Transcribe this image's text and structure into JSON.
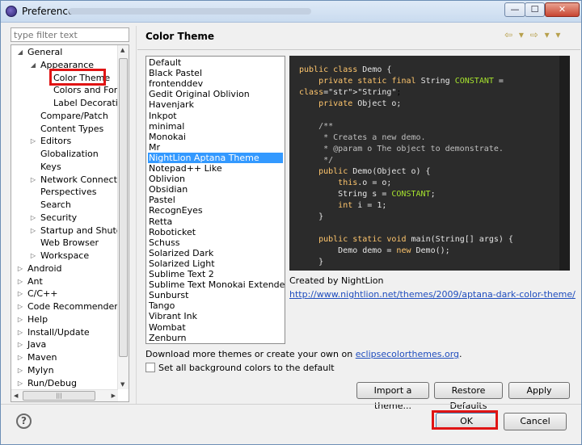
{
  "window": {
    "title": "Preferences",
    "controls": {
      "minimize": "—",
      "maximize": "☐",
      "close": "✕"
    }
  },
  "filter": {
    "placeholder": "type filter text"
  },
  "tree": [
    {
      "label": "General",
      "arrow": "▲",
      "depth": 0
    },
    {
      "label": "Appearance",
      "arrow": "▲",
      "depth": 1
    },
    {
      "label": "Color Theme",
      "arrow": "",
      "depth": 2
    },
    {
      "label": "Colors and Font",
      "arrow": "",
      "depth": 2
    },
    {
      "label": "Label Decoration",
      "arrow": "",
      "depth": 2
    },
    {
      "label": "Compare/Patch",
      "arrow": "",
      "depth": 1
    },
    {
      "label": "Content Types",
      "arrow": "",
      "depth": 1
    },
    {
      "label": "Editors",
      "arrow": "▷",
      "depth": 1
    },
    {
      "label": "Globalization",
      "arrow": "",
      "depth": 1
    },
    {
      "label": "Keys",
      "arrow": "",
      "depth": 1
    },
    {
      "label": "Network Connection",
      "arrow": "▷",
      "depth": 1
    },
    {
      "label": "Perspectives",
      "arrow": "",
      "depth": 1
    },
    {
      "label": "Search",
      "arrow": "",
      "depth": 1
    },
    {
      "label": "Security",
      "arrow": "▷",
      "depth": 1
    },
    {
      "label": "Startup and Shutdo",
      "arrow": "▷",
      "depth": 1
    },
    {
      "label": "Web Browser",
      "arrow": "",
      "depth": 1
    },
    {
      "label": "Workspace",
      "arrow": "▷",
      "depth": 1
    },
    {
      "label": "Android",
      "arrow": "▷",
      "depth": 0
    },
    {
      "label": "Ant",
      "arrow": "▷",
      "depth": 0
    },
    {
      "label": "C/C++",
      "arrow": "▷",
      "depth": 0
    },
    {
      "label": "Code Recommenders",
      "arrow": "▷",
      "depth": 0
    },
    {
      "label": "Help",
      "arrow": "▷",
      "depth": 0
    },
    {
      "label": "Install/Update",
      "arrow": "▷",
      "depth": 0
    },
    {
      "label": "Java",
      "arrow": "▷",
      "depth": 0
    },
    {
      "label": "Maven",
      "arrow": "▷",
      "depth": 0
    },
    {
      "label": "Mylyn",
      "arrow": "▷",
      "depth": 0
    },
    {
      "label": "Run/Debug",
      "arrow": "▷",
      "depth": 0
    }
  ],
  "panel": {
    "title": "Color Theme",
    "nav": "⇦ ▾ ⇨ ▾ ▾"
  },
  "themes": [
    "Default",
    "Black Pastel",
    "frontenddev",
    "Gedit Original Oblivion",
    "Havenjark",
    "Inkpot",
    "minimal",
    "Monokai",
    "Mr",
    "NightLion Aptana Theme",
    "Notepad++ Like",
    "Oblivion",
    "Obsidian",
    "Pastel",
    "RecognEyes",
    "Retta",
    "Roboticket",
    "Schuss",
    "Solarized Dark",
    "Solarized Light",
    "Sublime Text 2",
    "Sublime Text Monokai Extended",
    "Sunburst",
    "Tango",
    "Vibrant Ink",
    "Wombat",
    "Zenburn"
  ],
  "selected_theme": "NightLion Aptana Theme",
  "code_preview": [
    "public class Demo {",
    "    private static final String CONSTANT =",
    "\"String\";",
    "    private Object o;",
    "",
    "    /**",
    "     * Creates a new demo.",
    "     * @param o The object to demonstrate.",
    "     */",
    "    public Demo(Object o) {",
    "        this.o = o;",
    "        String s = CONSTANT;",
    "        int i = 1;",
    "    }",
    "",
    "    public static void main(String[] args) {",
    "        Demo demo = new Demo();",
    "    }"
  ],
  "created_by": "Created by NightLion",
  "theme_url": "http://www.nightlion.net/themes/2009/aptana-dark-color-theme/",
  "download": {
    "text": "Download more themes or create your own on ",
    "link": "eclipsecolorthemes.org",
    "suffix": "."
  },
  "checkbox": {
    "label": "Set all background colors to the default",
    "checked": false
  },
  "buttons": {
    "import": "Import a theme...",
    "restore": "Restore Defaults",
    "apply": "Apply",
    "ok": "OK",
    "cancel": "Cancel"
  },
  "help": "?",
  "colors": {
    "selection": "#3399ff",
    "highlight": "#e01414",
    "code_bg": "#2b2b2b",
    "link": "#1f4dbe"
  }
}
